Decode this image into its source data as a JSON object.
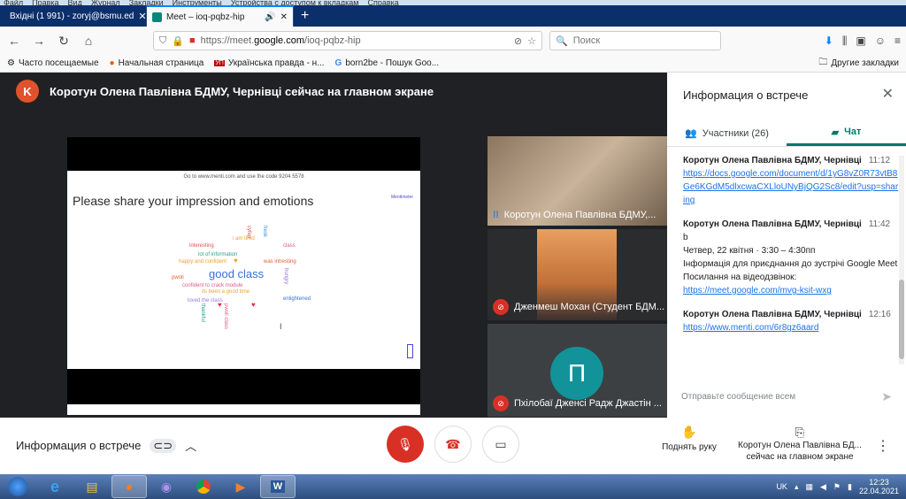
{
  "menubar": {
    "items": [
      "Файл",
      "Правка",
      "Вид",
      "Журнал",
      "Закладки",
      "Инструменты",
      "Устройства с доступом к вкладкам",
      "Справка"
    ]
  },
  "tabs": [
    {
      "label": "Вхідні (1 991) - zoryj@bsmu.ed",
      "favicon_color": "#d93025"
    },
    {
      "label": "Meet – ioq-pqbz-hip",
      "favicon_color": "#00897b"
    }
  ],
  "new_tab": "+",
  "url": {
    "prefix": "https://meet.",
    "host": "google.com",
    "path": "/ioq-pqbz-hip"
  },
  "search": {
    "placeholder": "Поиск"
  },
  "bookmarks": [
    {
      "label": "Часто посещаемые",
      "icon": "gear-icon"
    },
    {
      "label": "Начальная страница",
      "icon": "firefox-icon"
    },
    {
      "label": "Українська правда - н...",
      "icon": "up-icon"
    },
    {
      "label": "born2be - Пошук Goo...",
      "icon": "google-icon"
    }
  ],
  "other_bookmarks": "Другие закладки",
  "presenter": {
    "initial": "K",
    "text": "Коротун Олена Павлівна БДМУ, Чернівці сейчас на главном экране"
  },
  "slide": {
    "code_line": "Go to www.menti.com and use the code 9204 5578",
    "title": "Please share your impression and emotions",
    "logo": "Mentimeter",
    "words": [
      {
        "t": "i am tired",
        "c": "#f0a030"
      },
      {
        "t": "interesting",
        "c": "#e05050"
      },
      {
        "t": "cyfep",
        "c": "#e05050"
      },
      {
        "t": "fresk",
        "c": "#3a8fd8"
      },
      {
        "t": "class",
        "c": "#e05a8a"
      },
      {
        "t": "lot of information",
        "c": "#2aa090"
      },
      {
        "t": "happy and confident",
        "c": "#f0a030"
      },
      {
        "t": "was intresting",
        "c": "#e06030"
      },
      {
        "t": "good class",
        "c": "#3a6fd8"
      },
      {
        "t": "pwoli",
        "c": "#e06030"
      },
      {
        "t": "confident to crack module",
        "c": "#e05a8a"
      },
      {
        "t": "hungry",
        "c": "#9a7ad8"
      },
      {
        "t": "its been a good time",
        "c": "#f0a030"
      },
      {
        "t": "loved the class",
        "c": "#9a7ad8"
      },
      {
        "t": "enlightened",
        "c": "#3a6fd8"
      },
      {
        "t": "thankful",
        "c": "#2aa090"
      },
      {
        "t": "pwoli class",
        "c": "#e05a8a"
      }
    ]
  },
  "tiles": [
    {
      "name": "Коротун Олена Павлівна БДМУ,..."
    },
    {
      "name": "Дженмеш Мохан (Студент БДМ..."
    },
    {
      "name": "Пхілобаї Дженсі Радж Джастін ...",
      "initial": "П"
    }
  ],
  "panel": {
    "title": "Информация о встрече",
    "tab_people": "Участники (26)",
    "tab_chat": "Чат",
    "messages": [
      {
        "author": "Коротун Олена Павлівна БДМУ, Чернівці",
        "time": "11:12",
        "lines": [],
        "link": "https://docs.google.com/document/d/1yG8vZ0R73vtB8Ge6KGdM5dlxcwaCXLloUNyBjQG2Sc8/edit?usp=sharing"
      },
      {
        "author": "Коротун Олена Павлівна БДМУ, Чернівці",
        "time": "11:42",
        "lines": [
          "b",
          "Четвер, 22 квітня · 3:30 – 4:30пп",
          "Інформація для приєднання до зустрічі Google Meet",
          "Посилання на відеодзвінок:"
        ],
        "link": "https://meet.google.com/mvg-ksit-wxg"
      },
      {
        "author": "Коротун Олена Павлівна БДМУ, Чернівці",
        "time": "12:16",
        "lines": [],
        "link": "https://www.menti.com/6r8gz6aard"
      }
    ],
    "input_placeholder": "Отправьте сообщение всем"
  },
  "bottom": {
    "info_label": "Информация о встрече",
    "raise_hand": "Поднять руку",
    "presenting_line1": "Коротун Олена Павлівна БД...",
    "presenting_line2": "сейчас на главном экране"
  },
  "tray": {
    "lang": "UK",
    "time": "12:23",
    "date": "22.04.2021"
  }
}
